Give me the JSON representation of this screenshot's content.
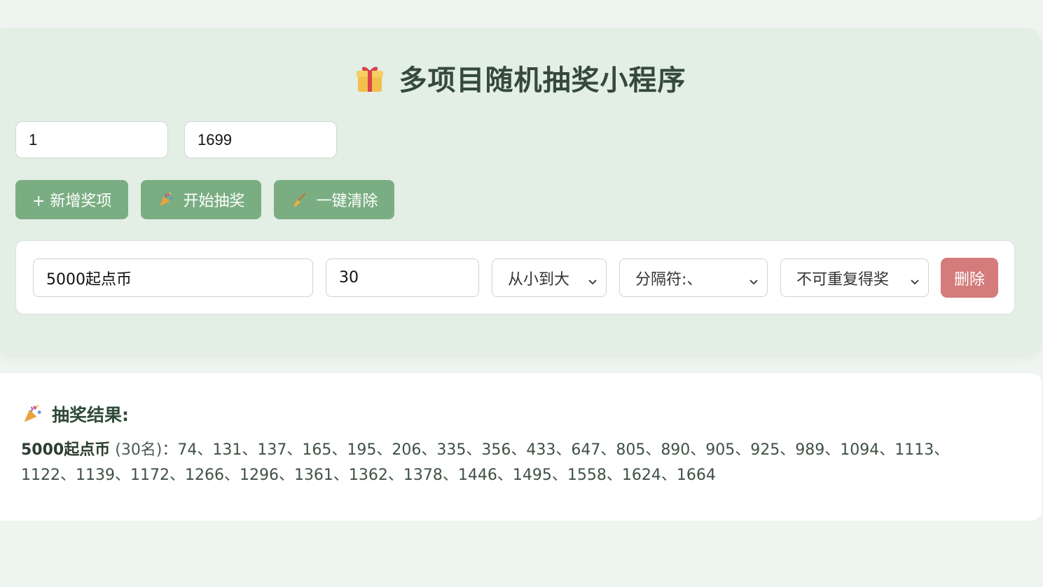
{
  "app": {
    "title": "多项目随机抽奖小程序"
  },
  "range": {
    "min_value": "1",
    "max_value": "1699"
  },
  "toolbar": {
    "add_label": "+ 新增奖项",
    "start_label": "开始抽奖",
    "clear_label": "一键清除"
  },
  "prize": {
    "name_value": "5000起点币",
    "count_value": "30",
    "sort_selected": "从小到大",
    "separator_selected": "分隔符:、",
    "repeat_selected": "不可重复得奖",
    "delete_label": "删除"
  },
  "results": {
    "title": "抽奖结果:",
    "items": [
      {
        "name": "5000起点币",
        "count_text": "(30名)",
        "numbers": "：74、131、137、165、195、206、335、356、433、647、805、890、905、925、989、1094、1113、1122、1139、1172、1266、1296、1361、1362、1378、1446、1495、1558、1624、1664"
      }
    ]
  },
  "icons": {
    "title": "gift-icon",
    "start": "party-popper-icon",
    "clear": "broom-icon",
    "results": "party-popper-icon"
  },
  "colors": {
    "accent": "#7aae82",
    "danger": "#d47b7b",
    "card": "#e3eee5",
    "background": "#eef5f1"
  }
}
